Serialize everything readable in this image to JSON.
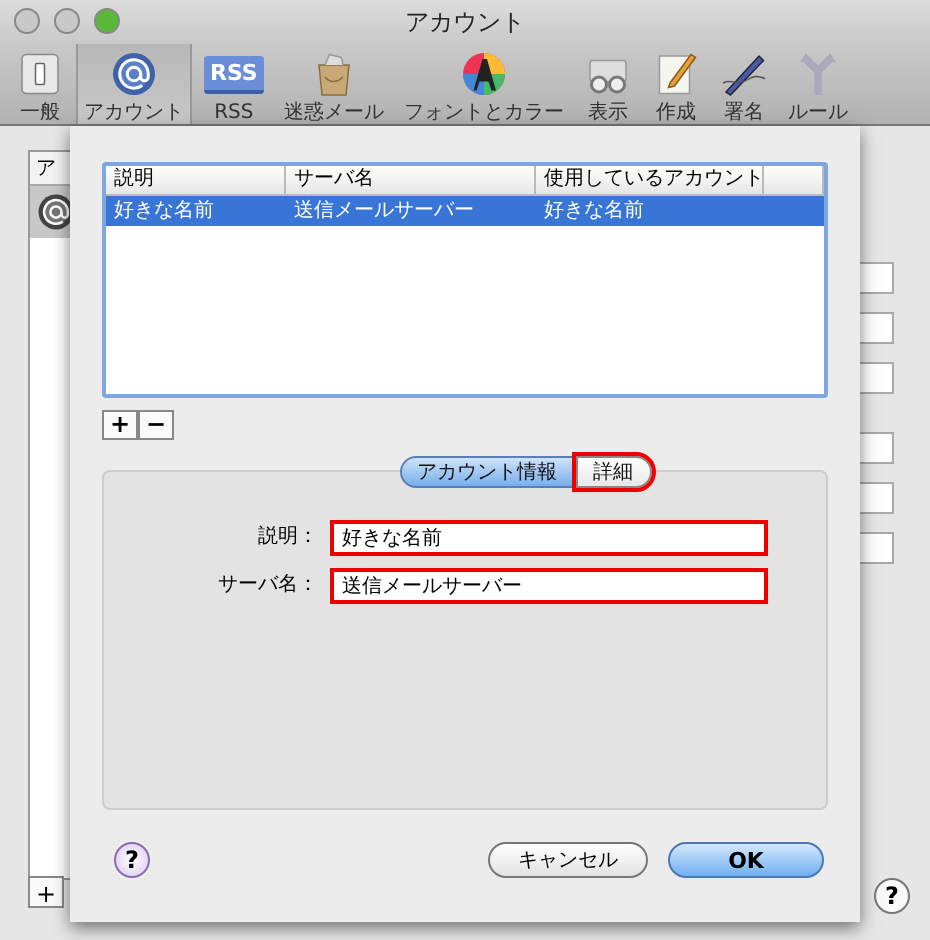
{
  "window": {
    "title": "アカウント"
  },
  "toolbar": [
    {
      "label": "一般",
      "kind": "switch",
      "selected": false
    },
    {
      "label": "アカウント",
      "kind": "at",
      "selected": true
    },
    {
      "label": "RSS",
      "kind": "rss",
      "icon_text": "RSS",
      "selected": false
    },
    {
      "label": "迷惑メール",
      "kind": "junk",
      "selected": false
    },
    {
      "label": "フォントとカラー",
      "kind": "font",
      "selected": false
    },
    {
      "label": "表示",
      "kind": "view",
      "selected": false
    },
    {
      "label": "作成",
      "kind": "compose",
      "selected": false
    },
    {
      "label": "署名",
      "kind": "signature",
      "selected": false
    },
    {
      "label": "ルール",
      "kind": "rules",
      "selected": false
    }
  ],
  "background": {
    "sidebar_header": "ア",
    "add_button": "+",
    "help_button": "?"
  },
  "sheet": {
    "table": {
      "columns": [
        "説明",
        "サーバ名",
        "使用しているアカウント"
      ],
      "rows": [
        {
          "cells": [
            "好きな名前",
            "送信メールサーバー",
            "好きな名前"
          ],
          "selected": true
        }
      ]
    },
    "list_buttons": [
      "+",
      "−"
    ],
    "tabs": [
      {
        "label": "アカウント情報",
        "selected": true,
        "highlighted": false
      },
      {
        "label": "詳細",
        "selected": false,
        "highlighted": true
      }
    ],
    "fields": [
      {
        "label": "説明：",
        "value": "好きな名前",
        "highlighted": true
      },
      {
        "label": "サーバ名：",
        "value": "送信メールサーバー",
        "highlighted": true
      }
    ],
    "help_button": "?",
    "buttons": [
      {
        "label": "キャンセル",
        "default": false
      },
      {
        "label": "OK",
        "default": true
      }
    ]
  }
}
